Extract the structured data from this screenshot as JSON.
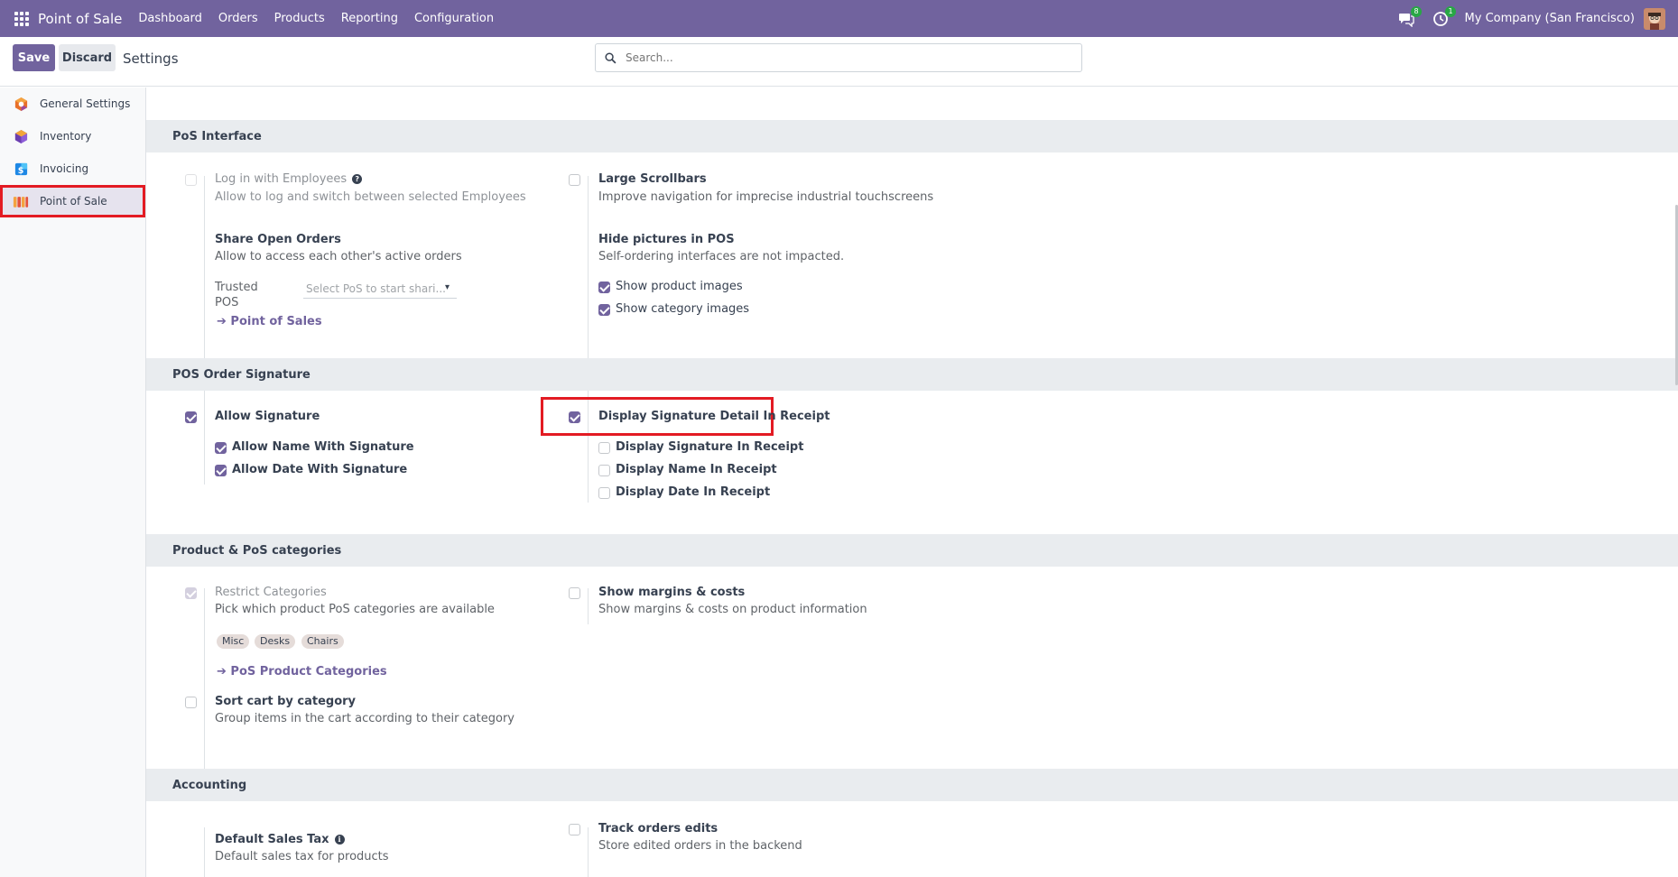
{
  "navbar": {
    "brand": "Point of Sale",
    "menu": [
      "Dashboard",
      "Orders",
      "Products",
      "Reporting",
      "Configuration"
    ],
    "messages_badge": "8",
    "activities_badge": "1",
    "company": "My Company (San Francisco)"
  },
  "control": {
    "save_label": "Save",
    "discard_label": "Discard",
    "title": "Settings",
    "search_placeholder": "Search..."
  },
  "sidebar": {
    "items": [
      {
        "label": "General Settings",
        "icon": "odoo-logo-icon"
      },
      {
        "label": "Inventory",
        "icon": "inventory-box-icon"
      },
      {
        "label": "Invoicing",
        "icon": "invoicing-icon"
      },
      {
        "label": "Point of Sale",
        "icon": "pos-shop-icon"
      }
    ],
    "active": "Point of Sale"
  },
  "sections": {
    "pos_interface": {
      "title": "PoS Interface",
      "login_employees": {
        "label": "Log in with Employees",
        "desc": "Allow to log and switch between selected Employees",
        "checked": false
      },
      "large_scrollbars": {
        "label": "Large Scrollbars",
        "desc": "Improve navigation for imprecise industrial touchscreens",
        "checked": false
      },
      "share_orders": {
        "label": "Share Open Orders",
        "desc": "Allow to access each other's active orders",
        "trusted_label_1": "Trusted",
        "trusted_label_2": "POS",
        "trusted_placeholder": "Select PoS to start shari...",
        "link": "Point of Sales"
      },
      "hide_pictures": {
        "label": "Hide pictures in POS",
        "desc": "Self-ordering interfaces are not impacted.",
        "show_product_images": "Show product images",
        "show_category_images": "Show category images"
      }
    },
    "signature": {
      "title": "POS Order Signature",
      "allow_signature": "Allow Signature",
      "allow_name": "Allow Name With Signature",
      "allow_date": "Allow Date With Signature",
      "display_detail": "Display Signature Detail In Receipt",
      "display_signature": "Display Signature In Receipt",
      "display_name": "Display Name In Receipt",
      "display_date": "Display Date In Receipt"
    },
    "categories": {
      "title": "Product & PoS categories",
      "restrict": {
        "label": "Restrict Categories",
        "desc": "Pick which product PoS categories are available"
      },
      "tags": [
        "Misc",
        "Desks",
        "Chairs"
      ],
      "link": "PoS Product Categories",
      "margins": {
        "label": "Show margins & costs",
        "desc": "Show margins & costs on product information"
      },
      "sort_cart": {
        "label": "Sort cart by category",
        "desc": "Group items in the cart according to their category"
      }
    },
    "accounting": {
      "title": "Accounting",
      "default_tax": {
        "label": "Default Sales Tax",
        "desc": "Default sales tax for products"
      },
      "track_edits": {
        "label": "Track orders edits",
        "desc": "Store edited orders in the backend"
      }
    }
  },
  "colors": {
    "primary": "#71639e",
    "highlight": "#e31b23",
    "section_bg": "#e9ecef"
  }
}
